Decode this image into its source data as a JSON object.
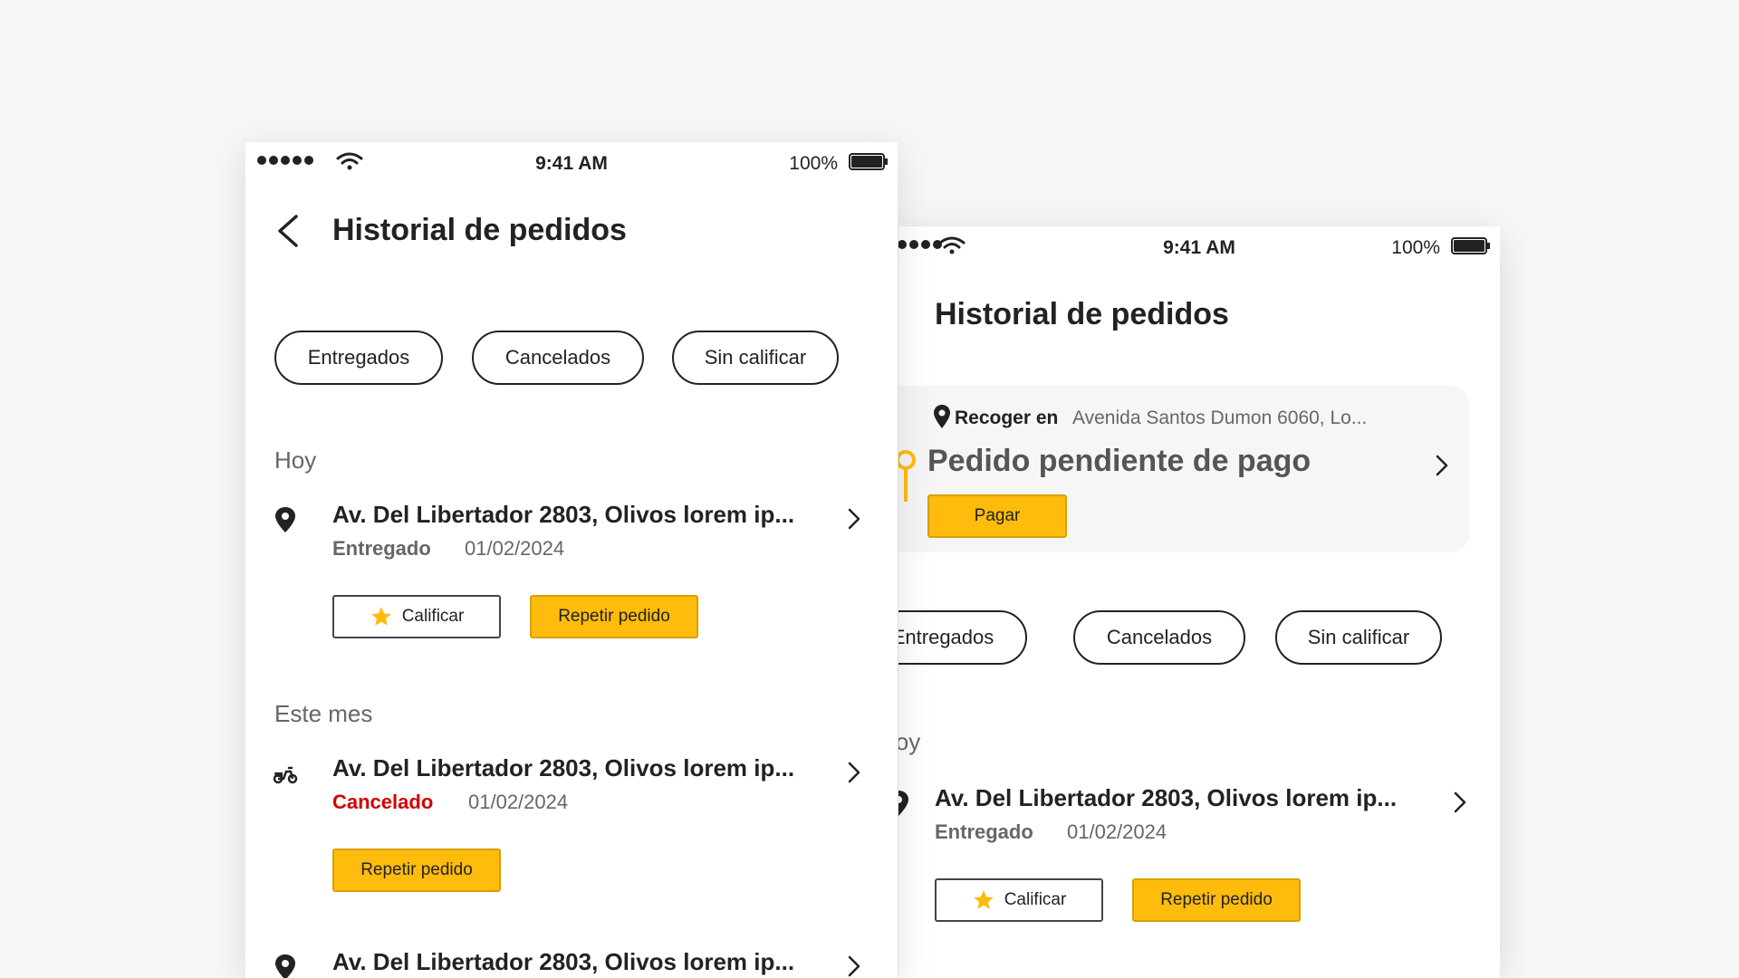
{
  "status_bar": {
    "time": "9:41 AM",
    "battery": "100%"
  },
  "header": {
    "title": "Historial de pedidos"
  },
  "filters": [
    "Entregados",
    "Cancelados",
    "Sin calificar"
  ],
  "sections": {
    "today": "Hoy",
    "this_month": "Este mes"
  },
  "orders": [
    {
      "address": "Av. Del Libertador 2803, Olivos lorem ip...",
      "status": "Entregado",
      "date": "01/02/2024",
      "icon": "location-pin-icon"
    },
    {
      "address": "Av. Del Libertador 2803, Olivos lorem ip...",
      "status": "Cancelado",
      "date": "01/02/2024",
      "icon": "scooter-icon"
    },
    {
      "address": "Av. Del Libertador 2803, Olivos lorem ip...",
      "icon": "location-pin-icon"
    }
  ],
  "actions": {
    "rate": "Calificar",
    "repeat": "Repetir pedido",
    "pay": "Pagar"
  },
  "pending": {
    "pickup_label": "Recoger en",
    "pickup_address": "Avenida Santos Dumon 6060, Lo...",
    "title": "Pedido pendiente de pago"
  },
  "colors": {
    "accent": "#ffbc0d",
    "cancel": "#d40000",
    "text": "#222222",
    "muted": "#666666"
  }
}
